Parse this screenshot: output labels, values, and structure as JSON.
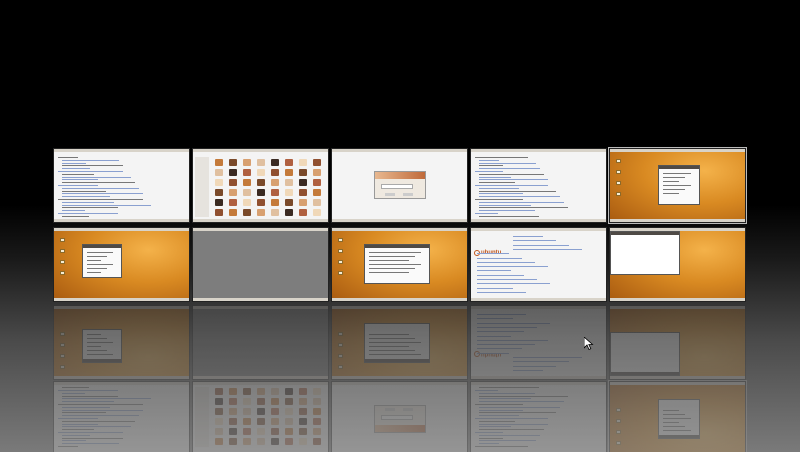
{
  "screen": {
    "description_free": true,
    "workspace_count": 10,
    "columns": 5,
    "rows": 2,
    "highlighted_workspace": 4
  },
  "workspaces": [
    {
      "id": "ws-1",
      "theme": "white",
      "content": "document"
    },
    {
      "id": "ws-2",
      "theme": "white",
      "content": "photo-grid"
    },
    {
      "id": "ws-3",
      "theme": "white",
      "content": "dialog"
    },
    {
      "id": "ws-4",
      "theme": "white",
      "content": "document"
    },
    {
      "id": "ws-5",
      "theme": "orange",
      "content": "window"
    },
    {
      "id": "ws-6",
      "theme": "orange",
      "content": "window"
    },
    {
      "id": "ws-7",
      "theme": "gray",
      "content": "empty"
    },
    {
      "id": "ws-8",
      "theme": "orange",
      "content": "window"
    },
    {
      "id": "ws-9",
      "theme": "white",
      "content": "ubuntu-page"
    },
    {
      "id": "ws-10",
      "theme": "orange",
      "content": "white-window"
    }
  ],
  "ubuntu_logo_text": "ubuntu",
  "colors": {
    "panel": "#d8d3c9",
    "orange_light": "#f4b24a",
    "orange_dark": "#a85a10",
    "link_blue": "#8aa0d0"
  }
}
